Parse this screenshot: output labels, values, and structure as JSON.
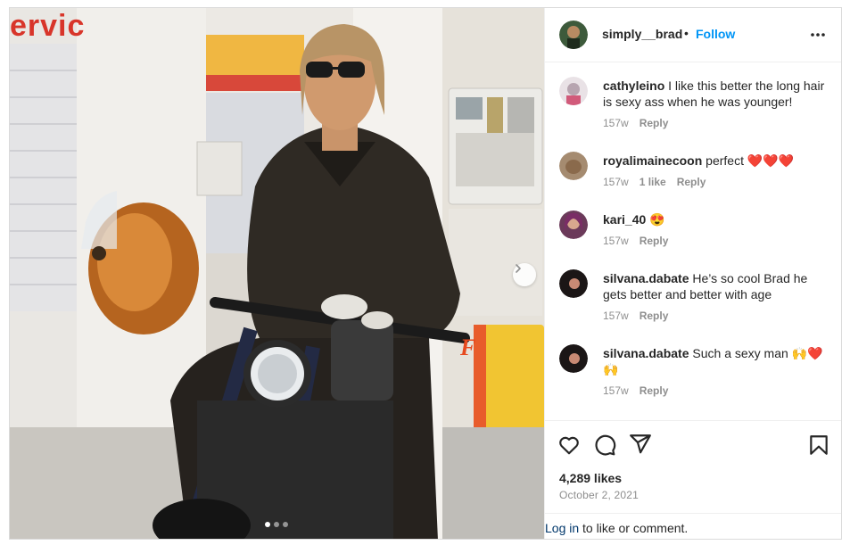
{
  "media": {
    "sign_text": "ervic",
    "shell_letter": "F",
    "carousel_total": 3,
    "carousel_active": 0
  },
  "header": {
    "username": "simply__brad",
    "separator": "•",
    "follow_label": "Follow"
  },
  "comments": [
    {
      "username": "cathyleino",
      "text": "I like this better the long hair is sexy ass when he was younger!",
      "time": "157w",
      "likes": "",
      "reply": "Reply"
    },
    {
      "username": "royalimainecoon",
      "text": "perfect ❤️❤️❤️",
      "time": "157w",
      "likes": "1 like",
      "reply": "Reply"
    },
    {
      "username": "kari_40",
      "text": "😍",
      "time": "157w",
      "likes": "",
      "reply": "Reply"
    },
    {
      "username": "silvana.dabate",
      "text": "He’s so cool Brad he gets better and better with age",
      "time": "157w",
      "likes": "",
      "reply": "Reply"
    },
    {
      "username": "silvana.dabate",
      "text": "Such a sexy man 🙌❤️🙌",
      "time": "157w",
      "likes": "",
      "reply": "Reply"
    }
  ],
  "post": {
    "likes": "4,289 likes",
    "date": "October 2, 2021"
  },
  "login": {
    "link": "Log in",
    "rest": " to like or comment."
  },
  "colors": {
    "follow": "#0095f6",
    "text": "#262626",
    "muted": "#8e8e8e",
    "border": "#dbdbdb",
    "link": "#00376b"
  }
}
